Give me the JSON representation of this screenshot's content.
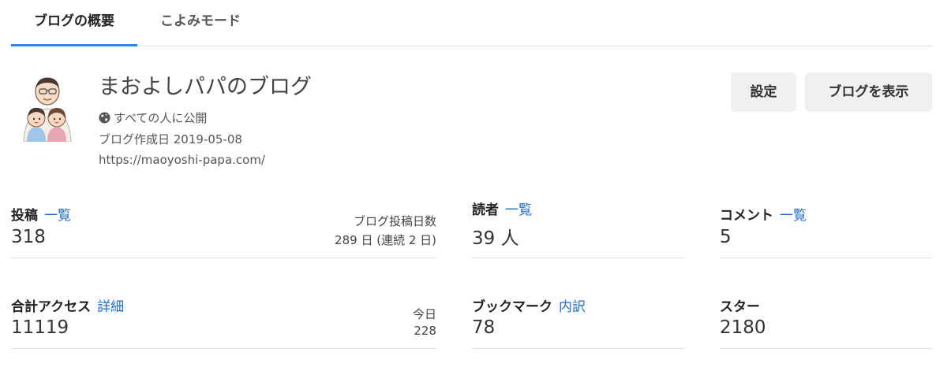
{
  "tabs": [
    {
      "label": "ブログの概要",
      "active": true
    },
    {
      "label": "こよみモード",
      "active": false
    }
  ],
  "blog": {
    "title": "まおよしパパのブログ",
    "visibility": "すべての人に公開",
    "created": "ブログ作成日 2019-05-08",
    "url": "https://maoyoshi-papa.com/"
  },
  "buttons": {
    "settings": "設定",
    "view_blog": "ブログを表示"
  },
  "stats": {
    "posts": {
      "label": "投稿",
      "link": "一覧",
      "value": "318",
      "side_label": "ブログ投稿日数",
      "side_value": "289 日 (連続 2 日)"
    },
    "readers": {
      "label": "読者",
      "link": "一覧",
      "value": "39 人"
    },
    "comments": {
      "label": "コメント",
      "link": "一覧",
      "value": "5"
    },
    "access": {
      "label": "合計アクセス",
      "link": "詳細",
      "value": "11119",
      "side_label": "今日",
      "side_value": "228"
    },
    "bookmarks": {
      "label": "ブックマーク",
      "link": "内訳",
      "value": "78"
    },
    "stars": {
      "label": "スター",
      "value": "2180"
    }
  },
  "colors": {
    "accent": "#2a8fd6",
    "link": "#1f6fc4",
    "button_bg": "#eef0f2",
    "divider": "#dde1e6"
  },
  "icons": {
    "visibility": "globe-icon",
    "avatar": "family-avatar"
  }
}
